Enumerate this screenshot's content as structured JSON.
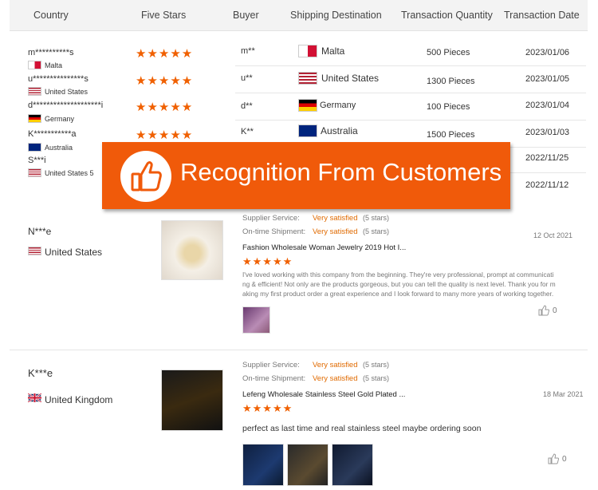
{
  "table": {
    "headers": [
      "Country",
      "Five Stars",
      "Buyer",
      "Shipping Destination",
      "Transaction Quantity",
      "Transaction Date"
    ],
    "left_rows": [
      {
        "name": "m**********s",
        "country": "Malta"
      },
      {
        "name": "u***************s",
        "country": "United States"
      },
      {
        "name": "d********************i",
        "country": "Germany"
      },
      {
        "name": "K***********a",
        "country": "Australia"
      },
      {
        "name": "S***i",
        "country": "United States 5"
      }
    ],
    "rows": [
      {
        "buyer": "m**",
        "dest": "Malta",
        "qty": "500 Pieces",
        "date": "2023/01/06",
        "stars": "★★★★★"
      },
      {
        "buyer": "u**",
        "dest": "United States",
        "qty": "1300 Pieces",
        "date": "2023/01/05",
        "stars": "★★★★★"
      },
      {
        "buyer": "d**",
        "dest": "Germany",
        "qty": "100 Pieces",
        "date": "2023/01/04",
        "stars": "★★★★★"
      },
      {
        "buyer": "K**",
        "dest": "Australia",
        "qty": "1500 Pieces",
        "date": "2023/01/03",
        "stars": "★★★★★"
      },
      {
        "date": "2022/11/25"
      },
      {
        "date": "2022/11/12"
      }
    ]
  },
  "banner": {
    "text": "Recognition From Customers",
    "icon": "thumbs-up-icon",
    "color": "#f05a0a"
  },
  "reviews": [
    {
      "name": "N***e",
      "country": "United States",
      "supplier_label": "Supplier Service:",
      "supplier_value": "Very satisfied",
      "supplier_stars": "(5 stars)",
      "shipment_label": "On-time Shipment:",
      "shipment_value": "Very satisfied",
      "shipment_stars": "(5 stars)",
      "product": "Fashion Wholesale Woman Jewelry 2019 Hot I...",
      "date": "12 Oct 2021",
      "rating": "★★★★★",
      "text_lines": [
        "I've loved working with this company from the beginning. They're very professional, prompt at communicati",
        "ng & efficient! Not only are the products gorgeous, but you can tell the quality is next level. Thank you for m",
        "aking my first product order a great experience and I look forward to many more years of working together."
      ],
      "likes": "0"
    },
    {
      "name": "K***e",
      "country": "United Kingdom",
      "supplier_label": "Supplier Service:",
      "supplier_value": "Very satisfied",
      "supplier_stars": "(5 stars)",
      "shipment_label": "On-time Shipment:",
      "shipment_value": "Very satisfied",
      "shipment_stars": "(5 stars)",
      "product": "Lefeng Wholesale Stainless Steel Gold Plated ...",
      "date": "18 Mar 2021",
      "rating": "★★★★★",
      "text": "perfect as last time and real stainless steel maybe ordering soon",
      "likes": "0"
    }
  ]
}
